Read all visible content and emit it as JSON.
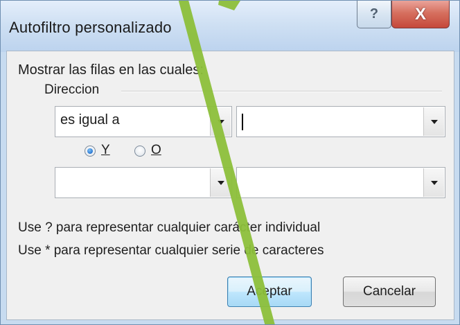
{
  "dialog": {
    "title": "Autofiltro personalizado",
    "help_glyph": "?",
    "close_glyph": "X"
  },
  "filter": {
    "prompt": "Mostrar las filas en las cuales:",
    "field_name": "Direccion",
    "row1": {
      "operator": "es igual a",
      "value": ""
    },
    "logic": {
      "and_label": "Y",
      "or_label": "O",
      "selected": "Y"
    },
    "row2": {
      "operator": "",
      "value": ""
    }
  },
  "hints": {
    "line1": "Use ? para representar cualquier carácter individual",
    "line2": "Use * para representar cualquier serie de caracteres"
  },
  "buttons": {
    "ok": "Aceptar",
    "cancel": "Cancelar"
  },
  "colors": {
    "pen_annotation": "#8cbf3a",
    "radio_selected": "#2d7bd4",
    "close_button": "#c5483a"
  },
  "icons": {
    "help": "question-mark-icon",
    "close": "close-x-icon",
    "dropdown": "triangle-down-icon"
  }
}
